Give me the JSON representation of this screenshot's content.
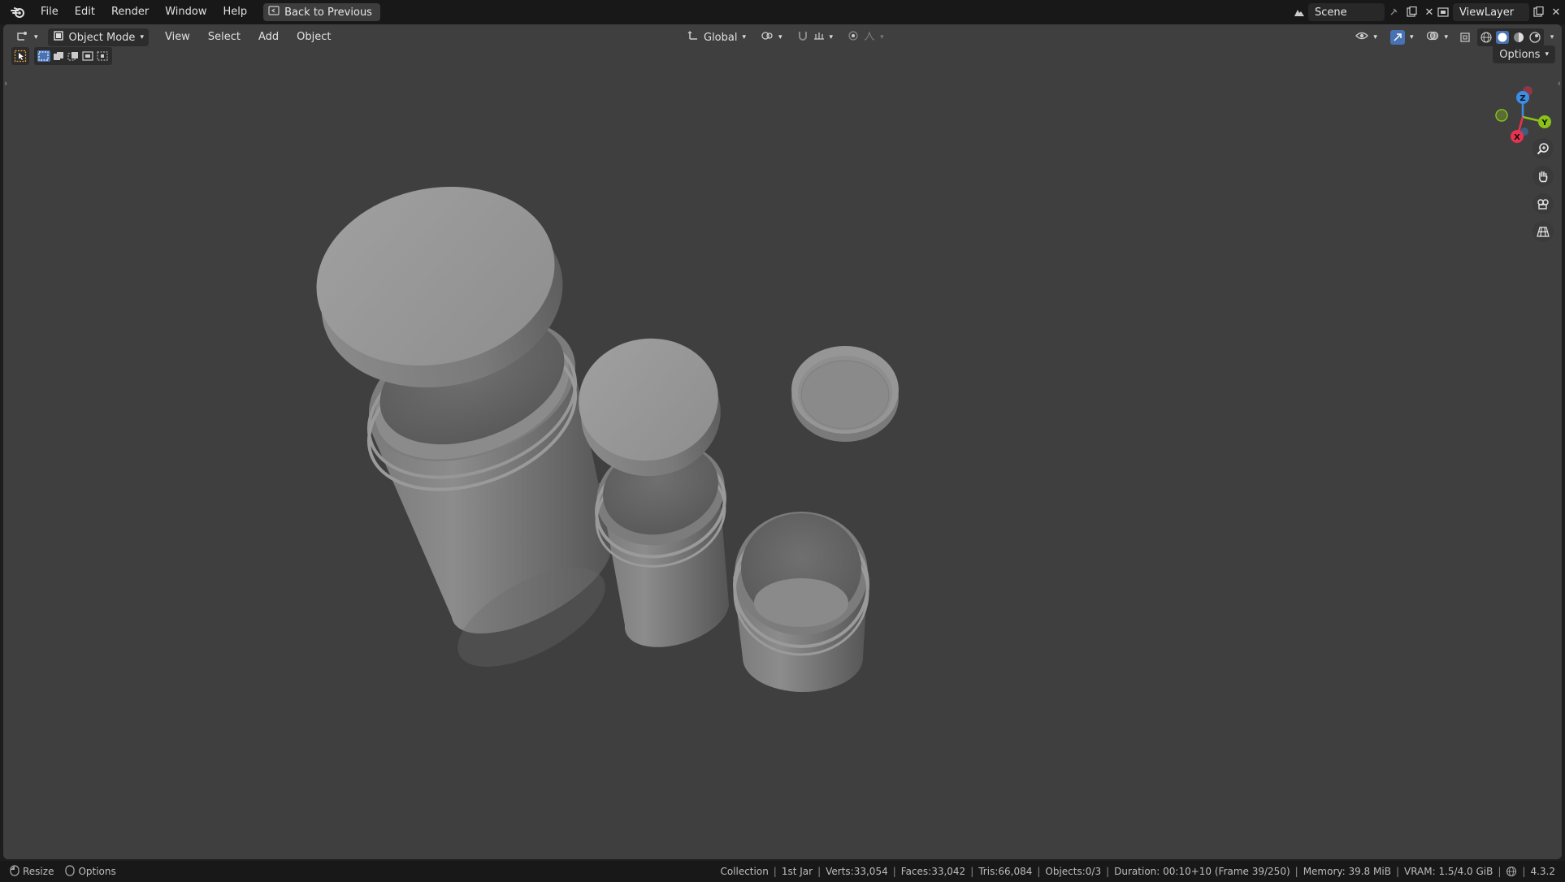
{
  "menu": {
    "items": [
      "File",
      "Edit",
      "Render",
      "Window",
      "Help"
    ],
    "back_button": "Back to Previous"
  },
  "scene": {
    "label": "Scene",
    "view_layer": "ViewLayer"
  },
  "viewport_header": {
    "mode": "Object Mode",
    "menus": [
      "View",
      "Select",
      "Add",
      "Object"
    ],
    "transform_orientation": "Global",
    "options_label": "Options"
  },
  "gizmo": {
    "z": "Z",
    "y": "Y",
    "x": "X"
  },
  "status": {
    "left": [
      "Resize",
      "Options"
    ],
    "collection": "Collection",
    "object": "1st Jar",
    "verts": "Verts:33,054",
    "faces": "Faces:33,042",
    "tris": "Tris:66,084",
    "objects": "Objects:0/3",
    "duration": "Duration: 00:10+10 (Frame 39/250)",
    "memory": "Memory: 39.8 MiB",
    "vram": "VRAM: 1.5/4.0 GiB",
    "version": "4.3.2"
  },
  "colors": {
    "viewport_bg": "#3f3f3f",
    "axis_x": "#e8334f",
    "axis_y": "#8bc21a",
    "axis_z": "#3b8de6"
  }
}
